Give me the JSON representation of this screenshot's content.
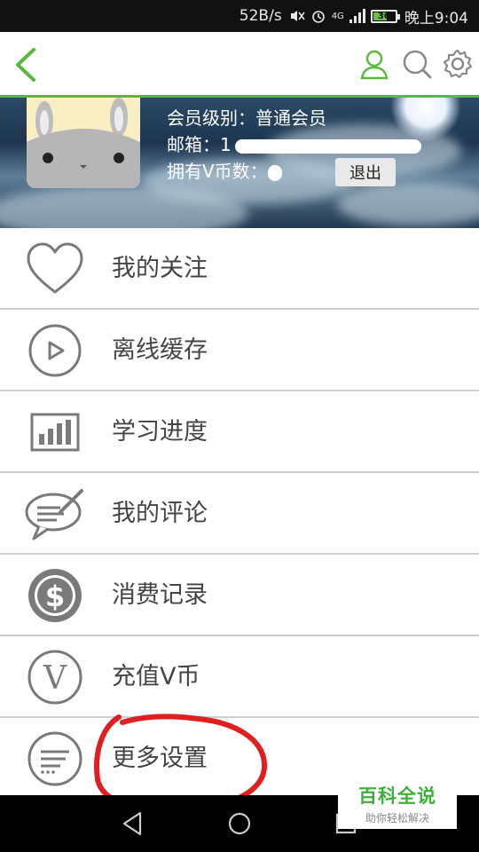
{
  "status_bar": {
    "speed": "52B/s",
    "network": "4G",
    "battery": "36",
    "time": "晚上9:04"
  },
  "header": {
    "back_icon": "chevron-left-icon",
    "user_icon": "user-icon",
    "search_icon": "search-icon",
    "settings_icon": "gear-icon",
    "accent_color": "#59b93e"
  },
  "profile": {
    "level_label": "会员级别：",
    "level_value": "普通会员",
    "email_label": "邮箱：",
    "email_value": "1",
    "coins_label": "拥有V币数：",
    "logout_label": "退出"
  },
  "menu": {
    "items": [
      {
        "icon": "heart-icon",
        "label": "我的关注"
      },
      {
        "icon": "play-circle-icon",
        "label": "离线缓存"
      },
      {
        "icon": "bar-chart-icon",
        "label": "学习进度"
      },
      {
        "icon": "comment-icon",
        "label": "我的评论"
      },
      {
        "icon": "dollar-circle-icon",
        "label": "消费记录"
      },
      {
        "icon": "v-coin-icon",
        "label": "充值V币"
      },
      {
        "icon": "more-settings-icon",
        "label": "更多设置"
      }
    ]
  },
  "watermark": {
    "title": "百科全说",
    "subtitle": "助你轻松解决"
  },
  "navbar": {
    "back_icon": "nav-back-icon",
    "home_icon": "nav-home-icon",
    "recents_icon": "nav-recents-icon"
  },
  "annotation_color": "#e02020"
}
